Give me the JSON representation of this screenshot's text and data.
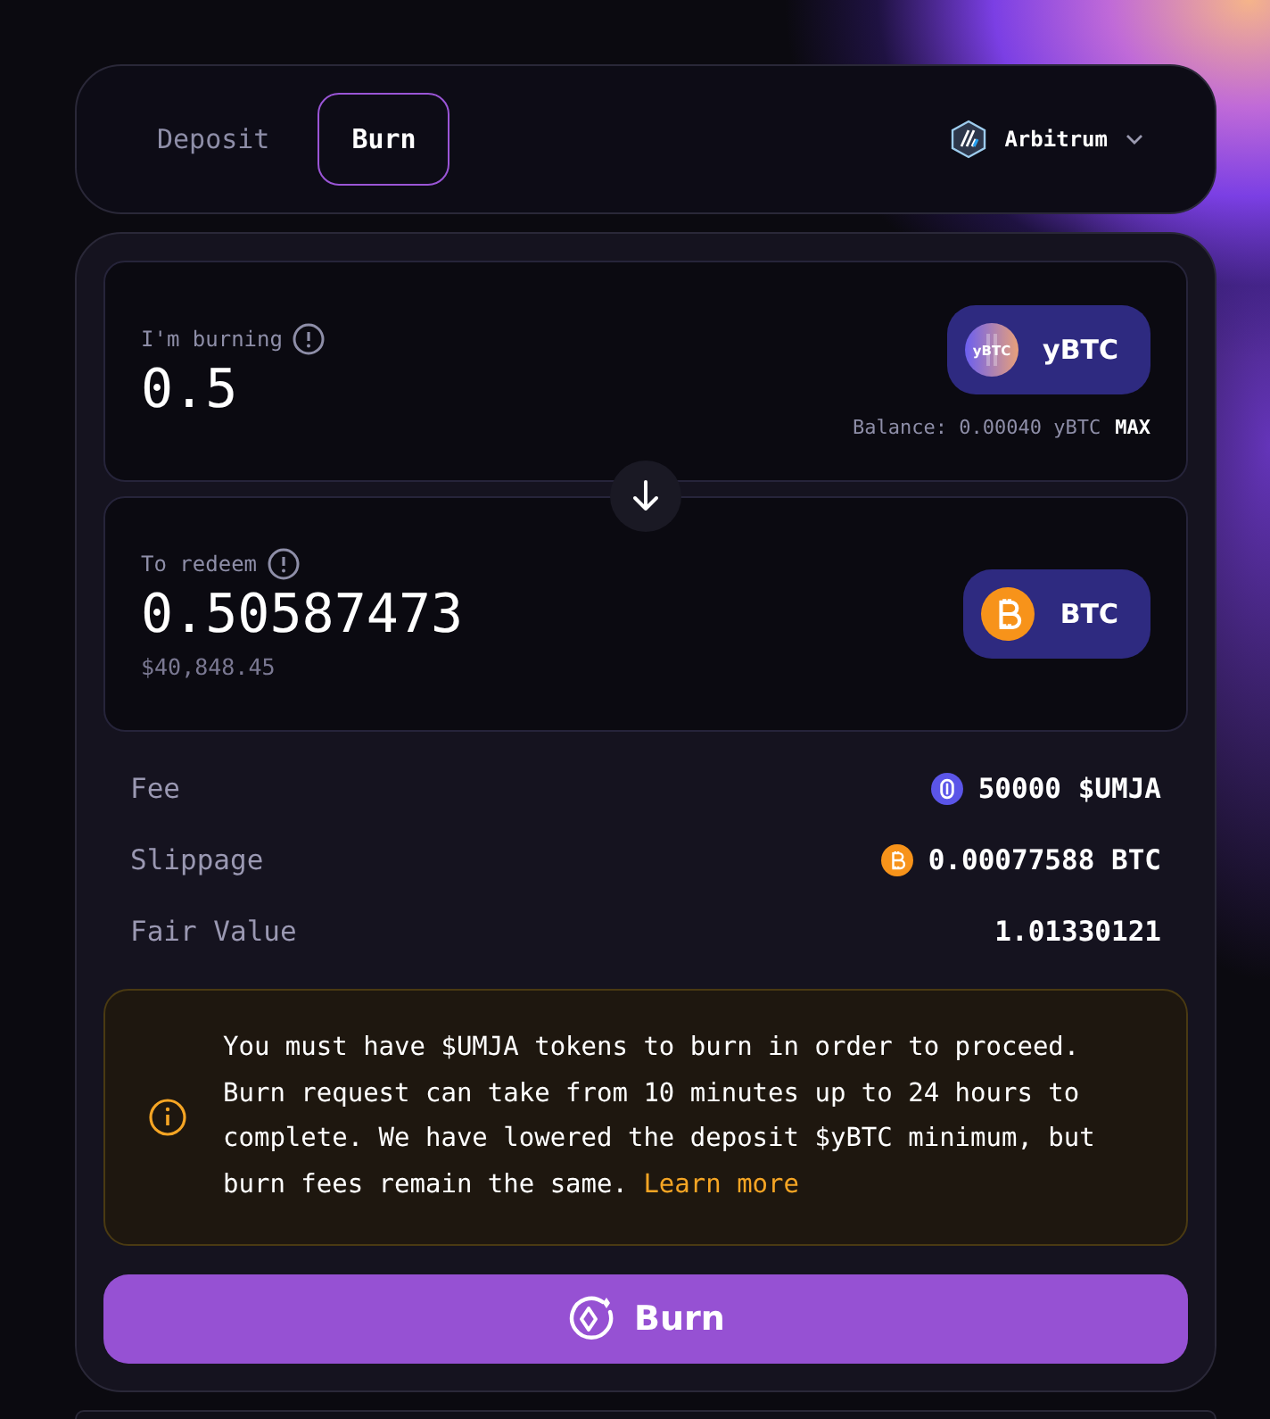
{
  "tabs": [
    {
      "label": "Deposit",
      "selected": false
    },
    {
      "label": "Burn",
      "selected": true
    }
  ],
  "network": {
    "label": "Arbitrum"
  },
  "burning": {
    "label": "I'm burning",
    "value": "0.5",
    "token": {
      "kind": "ybtc",
      "label": "yBTC",
      "badge": "yBTC"
    },
    "balance": "Balance: 0.00040 yBTC",
    "max": "MAX"
  },
  "redeem": {
    "label": "To redeem",
    "value": "0.50587473",
    "usd": "$40,848.45",
    "token": {
      "kind": "btc",
      "label": "BTC"
    }
  },
  "details": [
    {
      "label": "Fee",
      "kind": "umja",
      "value": "50000 $UMJA"
    },
    {
      "label": "Slippage",
      "kind": "btc",
      "value": "0.00077588 BTC"
    },
    {
      "label": "Fair Value",
      "kind": "none",
      "value": "1.01330121"
    }
  ],
  "notice": {
    "text": "You must have $UMJA tokens to burn in order to proceed. Burn request can take from 10 minutes up to 24 hours to complete. We have lowered the deposit $yBTC minimum, but burn fees remain the same.",
    "link": "Learn more"
  },
  "action": {
    "label": "Burn"
  }
}
